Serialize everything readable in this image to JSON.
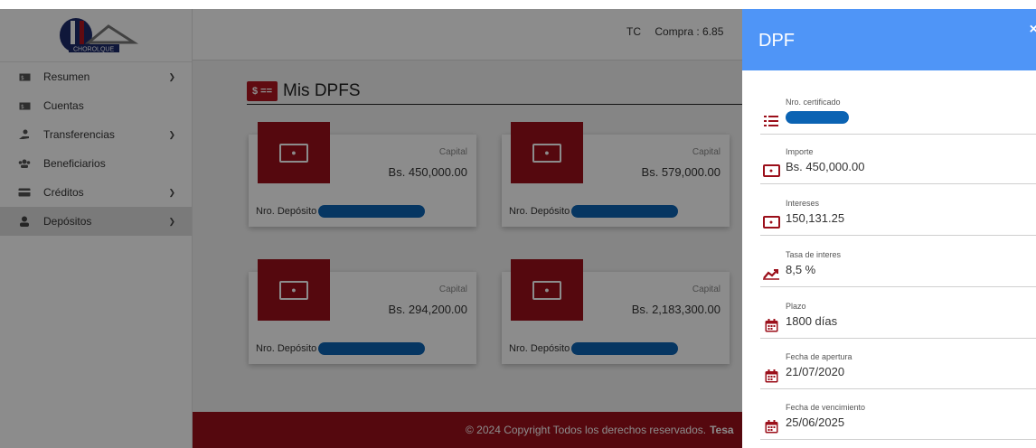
{
  "header": {
    "tc_label": "TC",
    "compra": "Compra : 6.85"
  },
  "sidebar": {
    "logo_text": "CHOROLQUE",
    "items": [
      {
        "label": "Resumen",
        "icon": "money-icon",
        "has_chevron": true
      },
      {
        "label": "Cuentas",
        "icon": "money-icon",
        "has_chevron": false
      },
      {
        "label": "Transferencias",
        "icon": "hand-coin-icon",
        "has_chevron": true
      },
      {
        "label": "Beneficiarios",
        "icon": "users-icon",
        "has_chevron": false
      },
      {
        "label": "Créditos",
        "icon": "card-icon",
        "has_chevron": true
      },
      {
        "label": "Depósitos",
        "icon": "user-icon",
        "has_chevron": true,
        "active": true
      }
    ]
  },
  "main": {
    "title_icon_text": "$ ==",
    "title": "Mis DPFS",
    "cards": [
      {
        "cap_label": "Capital",
        "cap_value": "Bs. 450,000.00",
        "dep_label": "Nro. Depósito :"
      },
      {
        "cap_label": "Capital",
        "cap_value": "Bs. 579,000.00",
        "dep_label": "Nro. Depósito :"
      },
      {
        "cap_label": "Capital",
        "cap_value": "Bs. 294,200.00",
        "dep_label": "Nro. Depósito :"
      },
      {
        "cap_label": "Capital",
        "cap_value": "Bs. 2,183,300.00",
        "dep_label": "Nro. Depósito :"
      }
    ]
  },
  "footer": {
    "text": "© 2024 Copyright Todos los derechos reservados.",
    "brand": "Tesa"
  },
  "panel": {
    "title": "DPF",
    "close": "×",
    "fields": [
      {
        "label": "Nro. certificado",
        "value": "",
        "redacted": true,
        "icon": "list-icon"
      },
      {
        "label": "Importe",
        "value": "Bs. 450,000.00",
        "icon": "money-icon"
      },
      {
        "label": "Intereses",
        "value": "150,131.25",
        "icon": "money-icon"
      },
      {
        "label": "Tasa de interes",
        "value": "8,5 %",
        "icon": "chart-line-icon"
      },
      {
        "label": "Plazo",
        "value": "1800 días",
        "icon": "calendar-icon"
      },
      {
        "label": "Fecha de apertura",
        "value": "21/07/2020",
        "icon": "calendar-icon"
      },
      {
        "label": "Fecha de vencimiento",
        "value": "25/06/2025",
        "icon": "calendar-icon"
      }
    ]
  },
  "colors": {
    "brand_red": "#9b0f1a",
    "panel_blue": "#4f95f7",
    "redact_blue": "#0b63b3"
  }
}
